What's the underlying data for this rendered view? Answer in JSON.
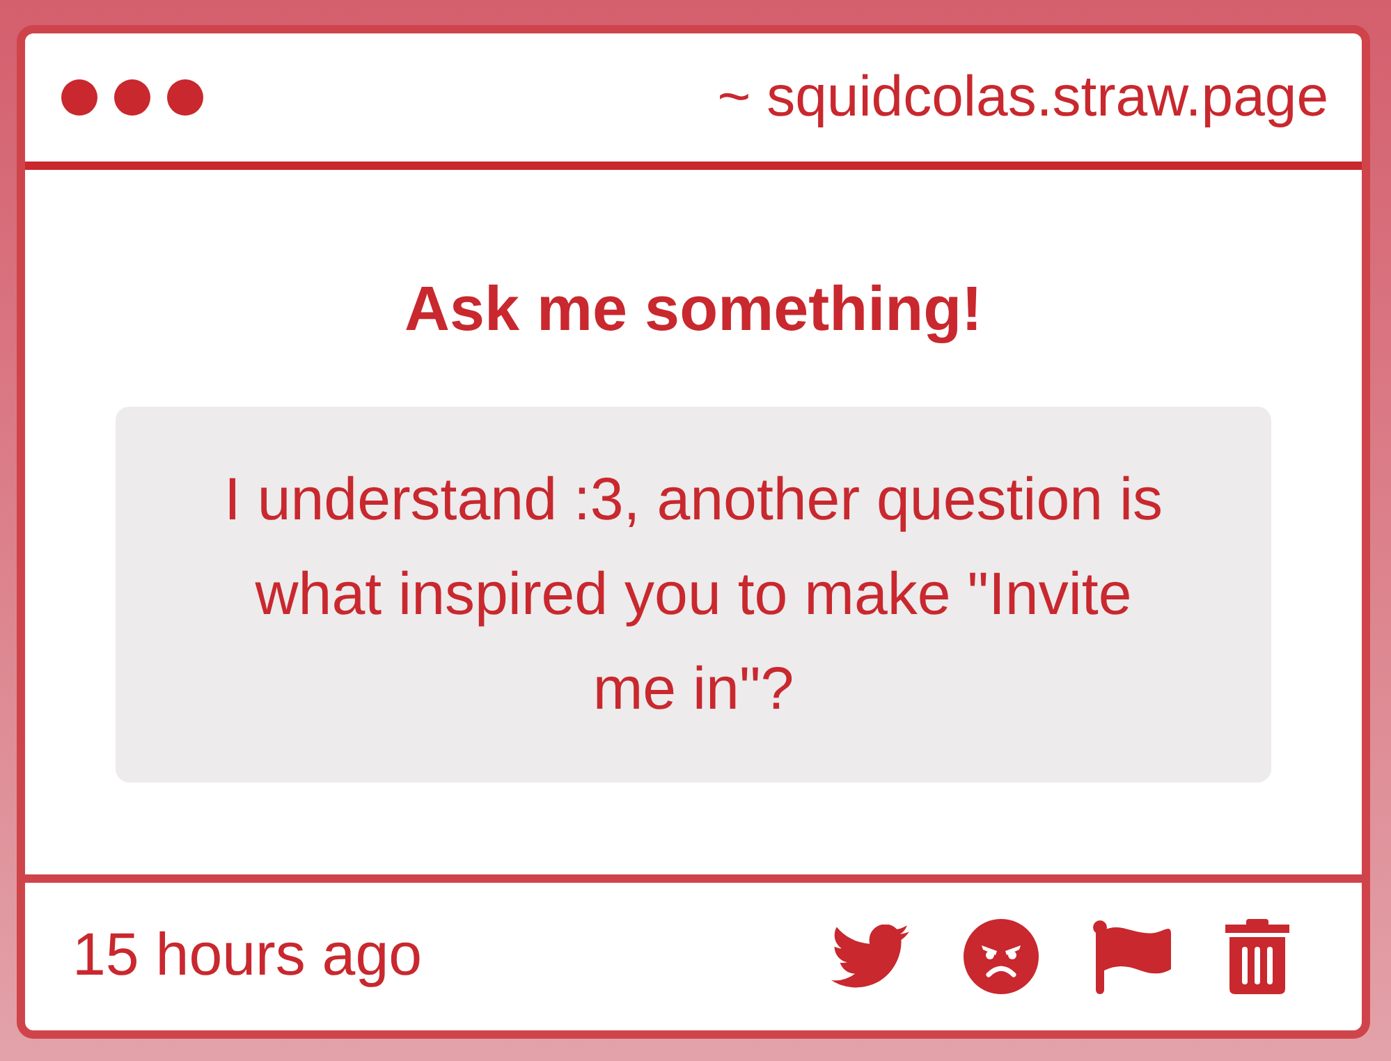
{
  "window": {
    "address": "~ squidcolas.straw.page"
  },
  "prompt": {
    "title": "Ask me something!"
  },
  "question": {
    "text": "I understand :3, another question is what inspired you to make \"Invite me in\"?"
  },
  "footer": {
    "time": "15 hours ago"
  }
}
